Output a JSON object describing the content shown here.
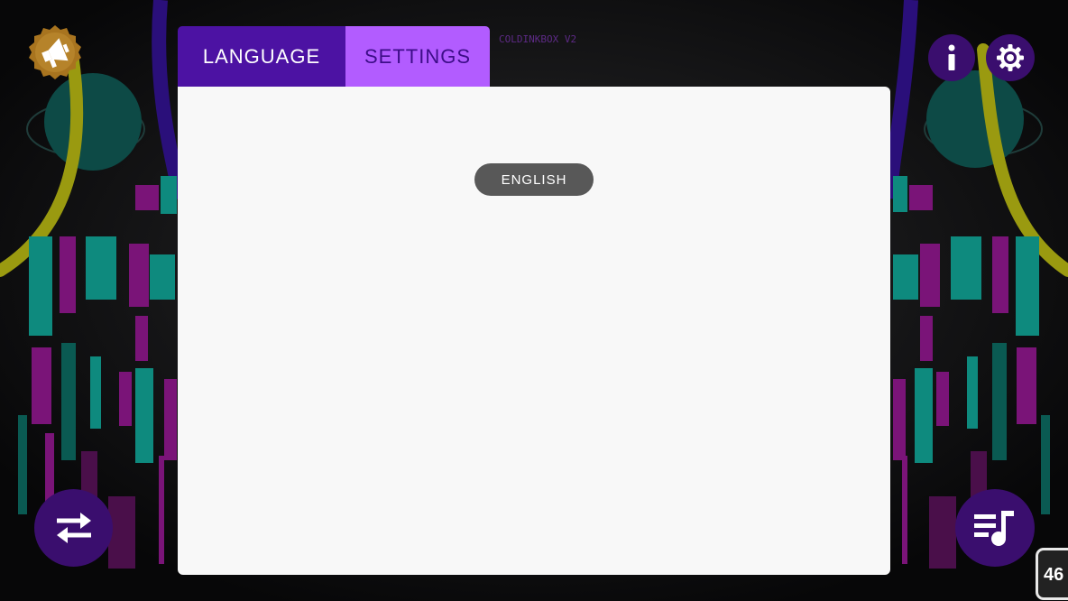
{
  "header": {
    "brand": "COLDINKBOX V2"
  },
  "tabs": [
    {
      "label": "LANGUAGE",
      "active": true
    },
    {
      "label": "SETTINGS",
      "active": false
    }
  ],
  "languages": {
    "options": [
      "ENGLISH"
    ]
  },
  "corner_badge": {
    "count": "46"
  },
  "colors": {
    "background": "#0c0b0d",
    "tab_active": "#4c12a3",
    "tab_inactive": "#b25cff",
    "panel": "#f8f8f8",
    "option_pill": "#585858",
    "round_button": "#3a0e6e",
    "badge_gold": "#a8741f"
  },
  "icons": {
    "top_left": "megaphone-icon",
    "top_right": [
      "info-icon",
      "gear-icon"
    ],
    "bottom_left": "swap-arrows-icon",
    "bottom_right": "playlist-music-icon"
  }
}
